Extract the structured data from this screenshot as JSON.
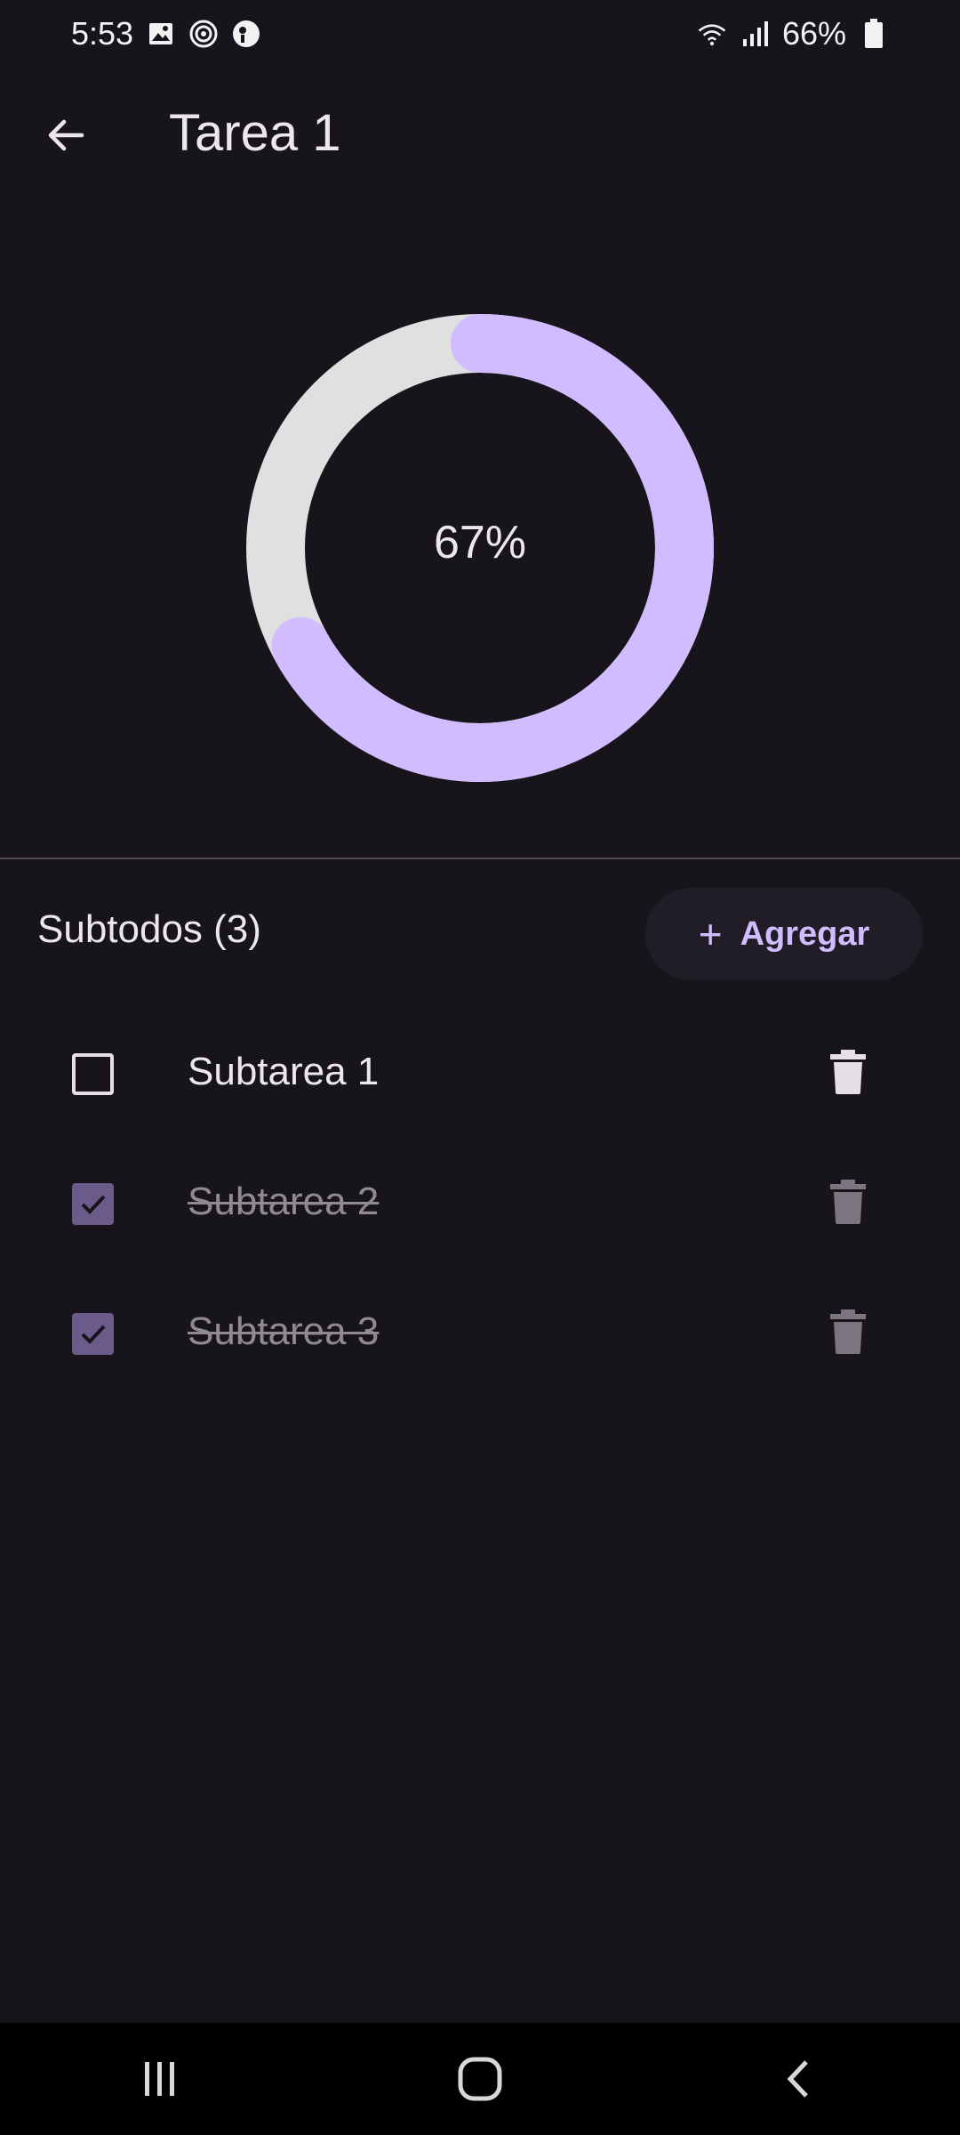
{
  "status_bar": {
    "time": "5:53",
    "left_icons": [
      "image-icon",
      "target-icon",
      "app-icon"
    ],
    "right_icons": [
      "wifi-icon",
      "signal-icon",
      "battery-icon"
    ],
    "battery": "66%"
  },
  "header": {
    "back_icon": "arrow-left-icon",
    "title": "Tarea 1"
  },
  "progress": {
    "percent_label": "67%",
    "value": 0.67,
    "track_color": "#e0e0e0",
    "fill_color": "#d0bcff"
  },
  "subtodos": {
    "header": "Subtodos (3)",
    "add_button": {
      "icon": "plus-icon",
      "label": "Agregar"
    },
    "items": [
      {
        "label": "Subtarea 1",
        "checked": false
      },
      {
        "label": "Subtarea 2",
        "checked": true
      },
      {
        "label": "Subtarea 3",
        "checked": true
      }
    ]
  },
  "nav_bar": {
    "items": [
      "recents-icon",
      "home-icon",
      "back-icon"
    ]
  },
  "colors": {
    "background": "#17141b",
    "accent": "#d0bcff",
    "checkbox_checked": "#6b5b8a"
  }
}
